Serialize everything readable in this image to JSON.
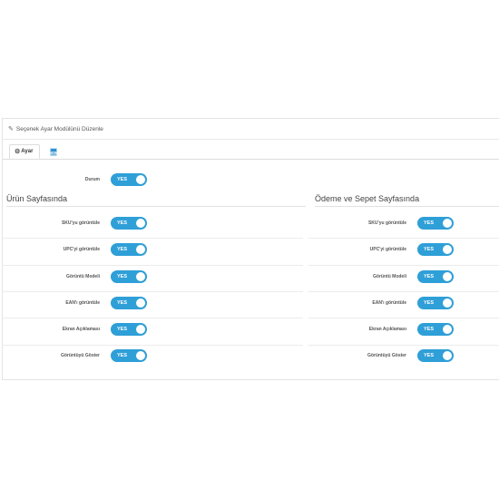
{
  "panel": {
    "title": "Seçenek Ayar Modülünü Düzenle"
  },
  "tabs": [
    {
      "label": "Ayar"
    },
    {
      "label": ""
    }
  ],
  "durum": {
    "label": "Durum",
    "value": "YES"
  },
  "left": {
    "title": "Ürün Sayfasında",
    "items": [
      {
        "label": "SKU'yu görüntüle",
        "value": "YES"
      },
      {
        "label": "UPC'yi görüntüle",
        "value": "YES"
      },
      {
        "label": "Görüntü Modeli",
        "value": "YES"
      },
      {
        "label": "EAN'ı görüntüle",
        "value": "YES"
      },
      {
        "label": "Ekran Açıklaması",
        "value": "YES"
      },
      {
        "label": "Görüntüyü Göster",
        "value": "YES"
      }
    ]
  },
  "right": {
    "title": "Ödeme ve Sepet Sayfasında",
    "items": [
      {
        "label": "SKU'yu görüntüle",
        "value": "YES"
      },
      {
        "label": "UPC'yi görüntüle",
        "value": "YES"
      },
      {
        "label": "Görüntü Modeli",
        "value": "YES"
      },
      {
        "label": "EAN'ı görüntüle",
        "value": "YES"
      },
      {
        "label": "Ekran Açıklaması",
        "value": "YES"
      },
      {
        "label": "Görüntüyü Göster",
        "value": "YES"
      }
    ]
  },
  "colors": {
    "toggle_on": "#2f9fd8",
    "tab_link": "#3a8fc9"
  }
}
